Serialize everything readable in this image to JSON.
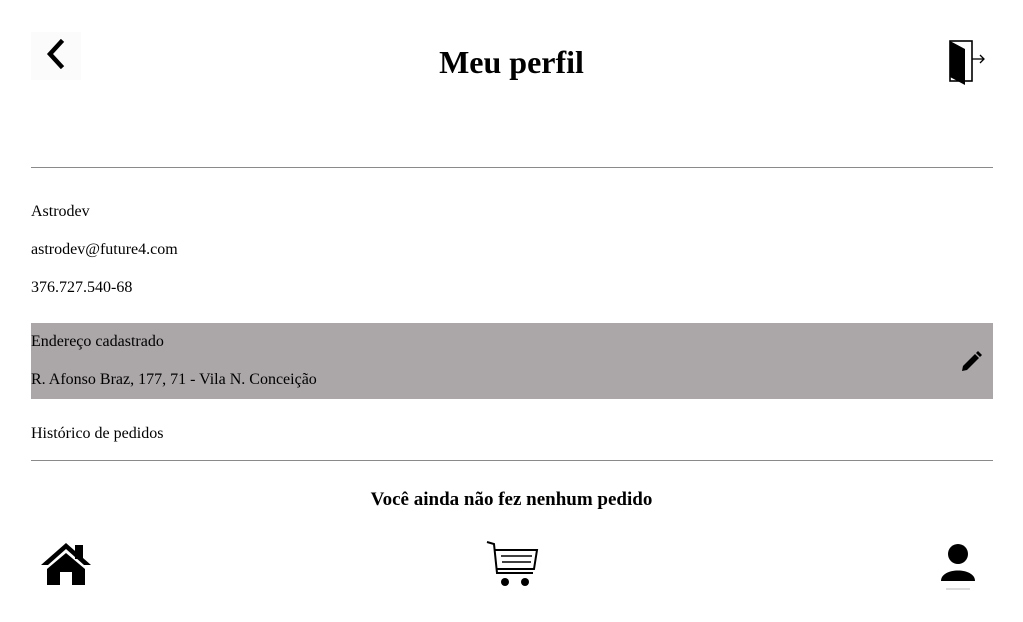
{
  "header": {
    "title": "Meu perfil",
    "back_icon": "chevron-left-icon",
    "logout_icon": "logout-door-icon"
  },
  "profile": {
    "name": "Astrodev",
    "email": "astrodev@future4.com",
    "cpf": "376.727.540-68"
  },
  "address": {
    "label": "Endereço cadastrado",
    "value": "R. Afonso Braz, 177, 71 - Vila N. Conceição",
    "edit_icon": "pencil-icon",
    "background_color": "#aba6a7"
  },
  "orders": {
    "heading": "Histórico de pedidos",
    "empty_message": "Você ainda não fez nenhum pedido"
  },
  "bottom_nav": {
    "items": [
      {
        "icon": "home-icon"
      },
      {
        "icon": "cart-icon"
      },
      {
        "icon": "user-icon"
      }
    ]
  }
}
